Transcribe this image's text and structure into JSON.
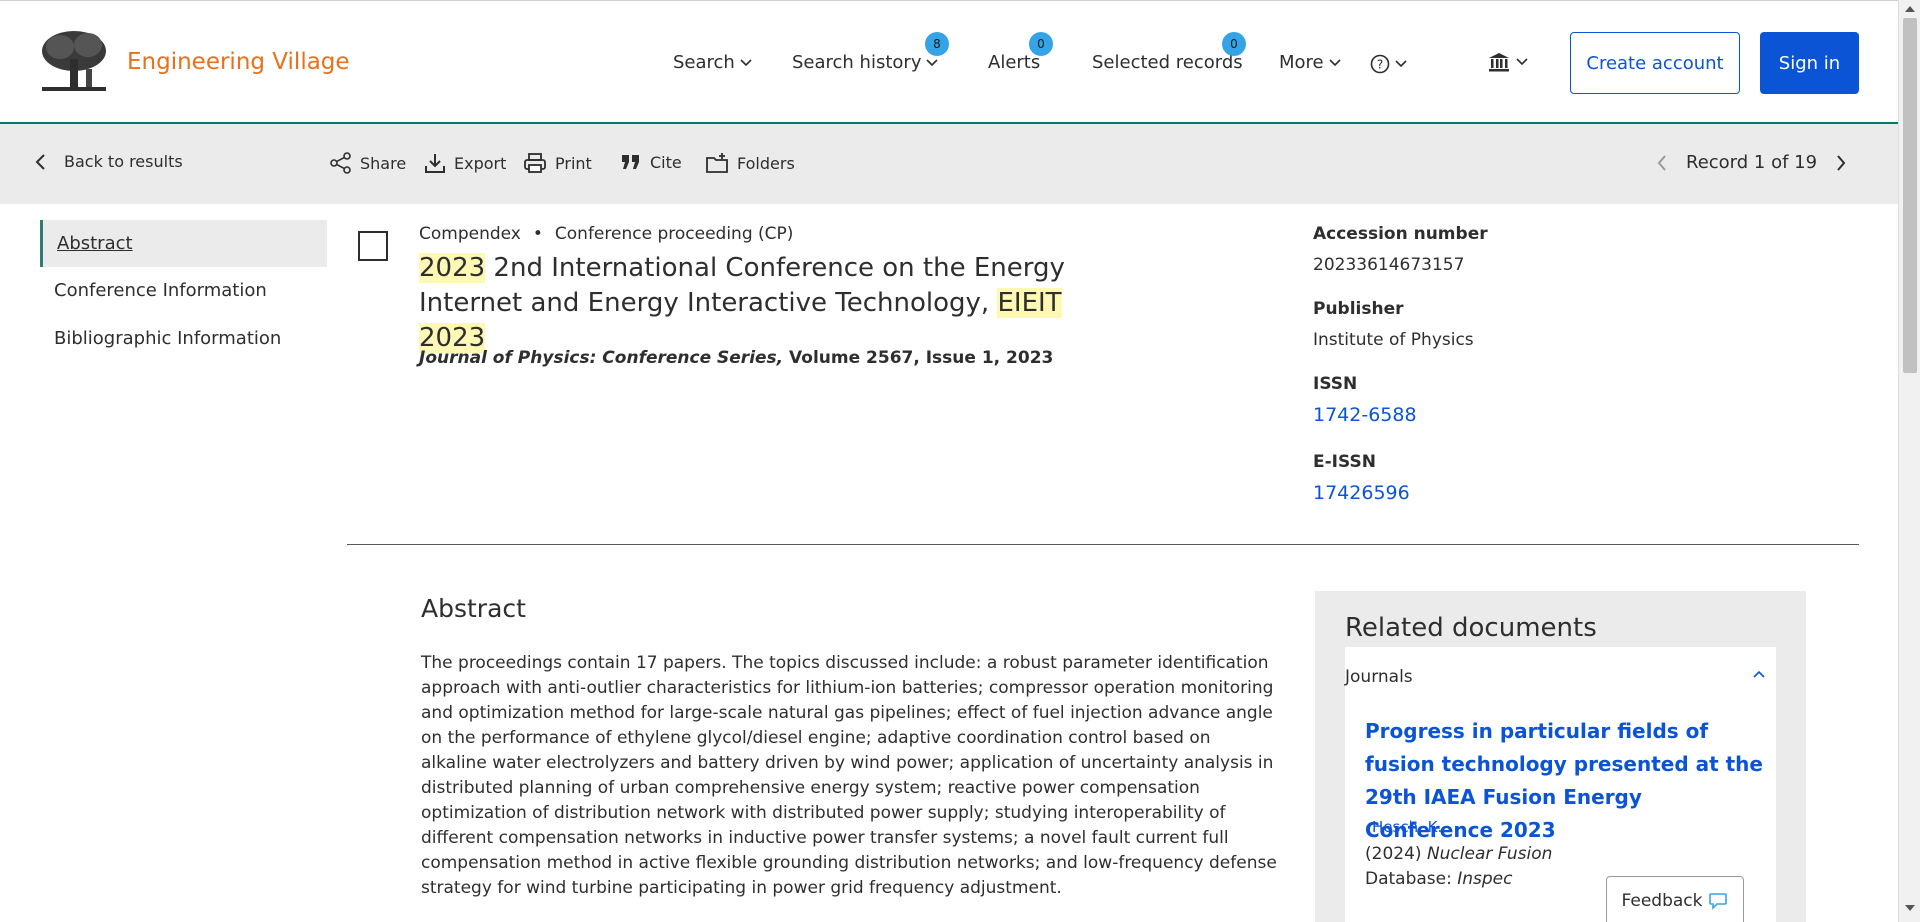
{
  "header": {
    "brand": "Engineering Village",
    "nav": {
      "search": "Search",
      "search_history": "Search history",
      "search_history_count": "8",
      "alerts": "Alerts",
      "alerts_count": "0",
      "selected_records": "Selected records",
      "selected_records_count": "0",
      "more": "More"
    },
    "create_account": "Create account",
    "sign_in": "Sign in"
  },
  "toolbar": {
    "back": "Back to results",
    "share": "Share",
    "export": "Export",
    "print": "Print",
    "cite": "Cite",
    "folders": "Folders",
    "record_position": "Record 1 of 19"
  },
  "sidebar": {
    "items": [
      {
        "label": "Abstract",
        "active": true
      },
      {
        "label": "Conference Information",
        "active": false
      },
      {
        "label": "Bibliographic Information",
        "active": false
      }
    ]
  },
  "record": {
    "database": "Compendex",
    "separator": "•",
    "doc_type": "Conference proceeding (CP)",
    "title_parts": {
      "p1": "2023",
      "p2": " 2nd International Conference on the Energy Internet and Energy Interactive Technology, ",
      "p3": "EIEIT",
      "p4": " ",
      "p5": "2023"
    },
    "journal_name": "Journal of Physics: Conference Series,",
    "journal_details": " Volume 2567, Issue 1, 2023",
    "accession_label": "Accession number",
    "accession_value": "20233614673157",
    "publisher_label": "Publisher",
    "publisher_value": "Institute of Physics",
    "issn_label": "ISSN",
    "issn_value": "1742-6588",
    "eissn_label": "E-ISSN",
    "eissn_value": "17426596"
  },
  "abstract": {
    "heading": "Abstract",
    "text": "The proceedings contain 17 papers. The topics discussed include: a robust parameter identification approach with anti-outlier characteristics for lithium-ion batteries; compressor operation monitoring and optimization method for large-scale natural gas pipelines; effect of fuel injection advance angle on the performance of ethylene glycol/diesel engine; adaptive coordination control based on alkaline water electrolyzers and battery driven by wind power; application of uncertainty analysis in distributed planning of urban comprehensive energy system; reactive power compensation optimization of distribution network with distributed power supply; studying interoperability of different compensation networks in inductive power transfer systems; a novel fault current full compensation method in active flexible grounding distribution networks; and low-frequency defense strategy for wind turbine participating in power grid frequency adjustment."
  },
  "related": {
    "heading": "Related documents",
    "category": "Journals",
    "item": {
      "title": "Progress in particular fields of fusion technology presented at the 29th IAEA Fusion Energy Conference 2023",
      "author": "Hesch, K.",
      "year": "(2024)",
      "source": "Nuclear Fusion",
      "db_label": "Database:",
      "db_value": "Inspec"
    }
  },
  "feedback": "Feedback",
  "colors": {
    "brand": "#e9711c",
    "link": "#0c54d6",
    "accent_line": "#007b6e",
    "badge": "#35a4e6",
    "highlight": "#fdf8b4"
  }
}
